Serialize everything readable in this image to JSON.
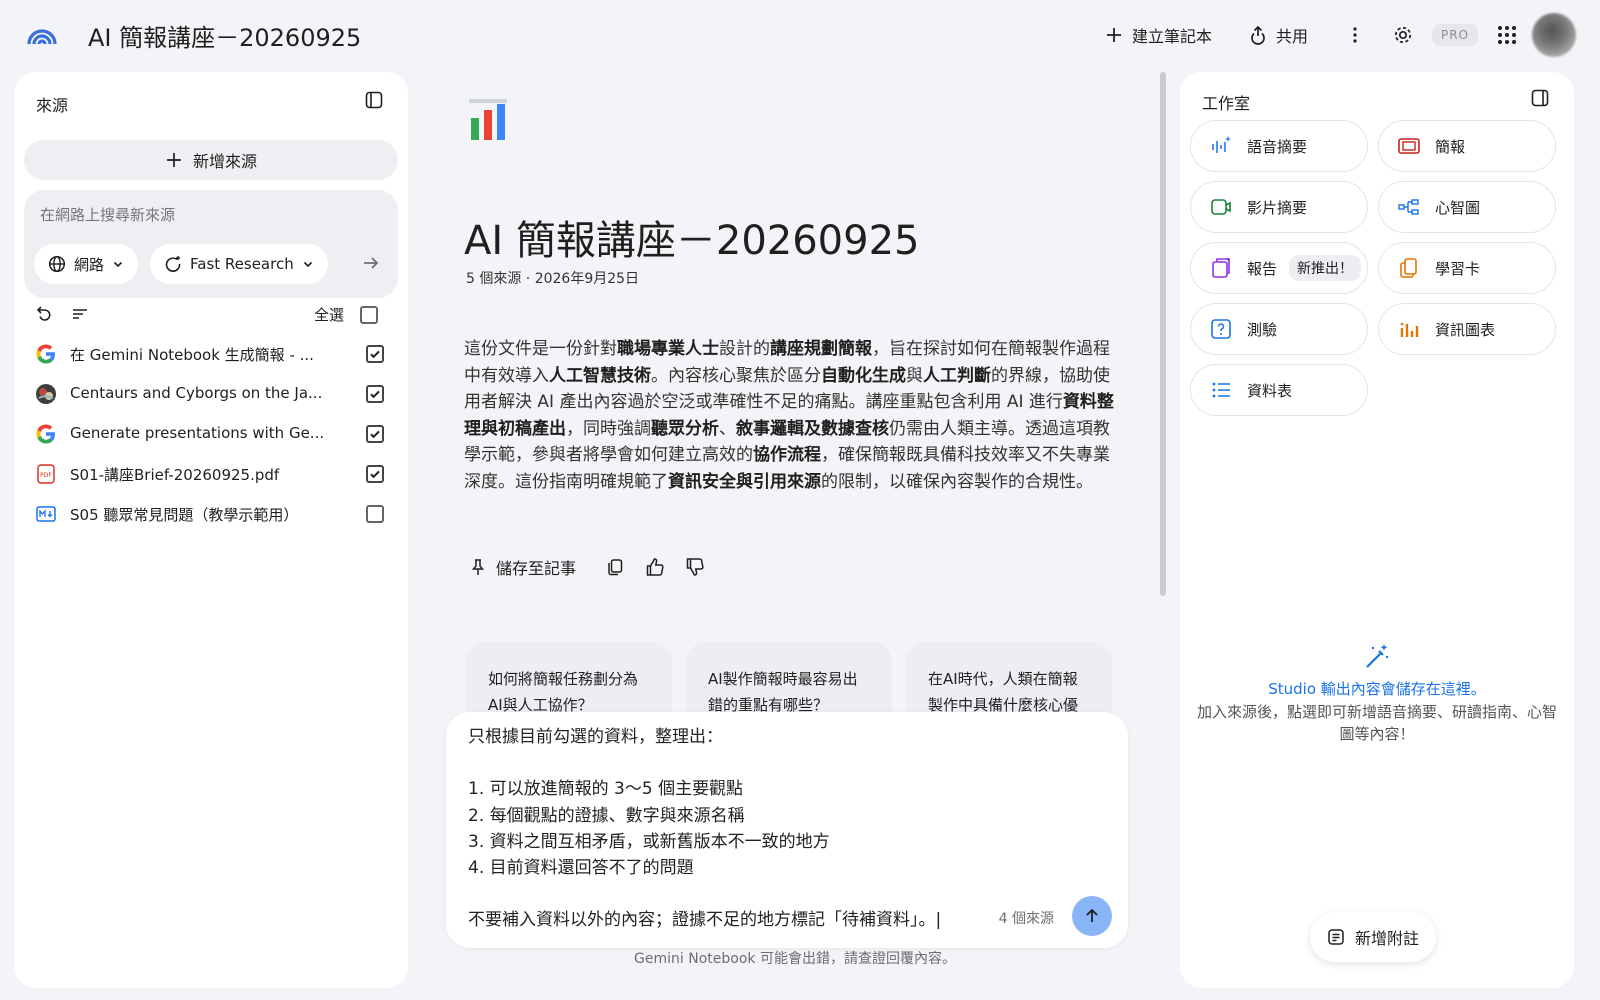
{
  "app": {
    "title": "AI 簡報講座－20260925"
  },
  "topbar": {
    "create_notebook_label": "建立筆記本",
    "share_label": "共用",
    "pro_badge": "PRO",
    "icons": [
      "plus-icon",
      "share-icon",
      "more-vert-icon",
      "settings-icon",
      "apps-grid-icon",
      "avatar"
    ]
  },
  "sources_panel": {
    "title": "來源",
    "add_source_label": "新增來源",
    "search": {
      "placeholder": "在網路上搜尋新來源",
      "value": ""
    },
    "web_chip_label": "網路",
    "research_chip_label": "Fast Research",
    "select_all_label": "全選",
    "items": [
      {
        "title": "在 Gemini Notebook 生成簡報 - ...",
        "icon": "google-icon",
        "checked": true
      },
      {
        "title": "Centaurs and Cyborgs on the Ja...",
        "icon": "web-thumbnail-icon",
        "checked": true
      },
      {
        "title": "Generate presentations with Ge...",
        "icon": "google-icon",
        "checked": true
      },
      {
        "title": "S01-講座Brief-20260925.pdf",
        "icon": "pdf-icon",
        "checked": true
      },
      {
        "title": "S05 聽眾常見問題（教學示範用）",
        "icon": "markdown-icon",
        "checked": false
      }
    ]
  },
  "main": {
    "title": "AI 簡報講座－20260925",
    "meta": "5 個來源 · 2026年9月25日",
    "summary_segments": [
      {
        "t": "這份文件是一份針對"
      },
      {
        "t": "職場專業人士",
        "b": true
      },
      {
        "t": "設計的"
      },
      {
        "t": "講座規劃簡報",
        "b": true
      },
      {
        "t": "，旨在探討如何在簡報製作過程中有效導入"
      },
      {
        "t": "人工智慧技術",
        "b": true
      },
      {
        "t": "。內容核心聚焦於區分"
      },
      {
        "t": "自動化生成",
        "b": true
      },
      {
        "t": "與"
      },
      {
        "t": "人工判斷",
        "b": true
      },
      {
        "t": "的界線，協助使用者解決 AI 產出內容過於空泛或準確性不足的痛點。講座重點包含利用 AI 進行"
      },
      {
        "t": "資料整理與初稿產出",
        "b": true
      },
      {
        "t": "，同時強調"
      },
      {
        "t": "聽眾分析",
        "b": true
      },
      {
        "t": "、"
      },
      {
        "t": "敘事邏輯及數據查核",
        "b": true
      },
      {
        "t": "仍需由人類主導。透過這項教學示範，參與者將學會如何建立高效的"
      },
      {
        "t": "協作流程",
        "b": true
      },
      {
        "t": "，確保簡報既具備科技效率又不失專業深度。這份指南明確規範了"
      },
      {
        "t": "資訊安全與引用來源",
        "b": true
      },
      {
        "t": "的限制，以確保內容製作的合規性。"
      }
    ],
    "save_note_label": "儲存至記事",
    "suggestions": [
      "如何將簡報任務劃分為AI與人工協作？",
      "AI製作簡報時最容易出錯的重點有哪些？",
      "在AI時代，人類在簡報製作中具備什麼核心優勢？"
    ],
    "composer_text": "只根據目前勾選的資料，整理出：\n\n1. 可以放進簡報的 3～5 個主要觀點\n2. 每個觀點的證據、數字與來源名稱\n3. 資料之間互相矛盾，或新舊版本不一致的地方\n4. 目前資料還回答不了的問題\n\n不要補入資料以外的內容；證據不足的地方標記「待補資料」。|",
    "source_count": "4 個來源",
    "disclaimer": "Gemini Notebook 可能會出錯，請查證回覆內容。"
  },
  "studio": {
    "title": "工作室",
    "tiles": [
      {
        "label": "語音摘要",
        "icon": "audio-overview-icon"
      },
      {
        "label": "簡報",
        "icon": "slides-icon"
      },
      {
        "label": "影片摘要",
        "icon": "video-overview-icon"
      },
      {
        "label": "心智圖",
        "icon": "mind-map-icon"
      },
      {
        "label": "報告",
        "icon": "report-icon",
        "badge": "新推出！"
      },
      {
        "label": "學習卡",
        "icon": "flashcards-icon"
      },
      {
        "label": "測驗",
        "icon": "quiz-icon"
      },
      {
        "label": "資訊圖表",
        "icon": "infographic-icon"
      },
      {
        "label": "資料表",
        "icon": "data-table-icon"
      }
    ],
    "empty_title": "Studio 輸出內容會儲存在這裡。",
    "empty_desc": "加入來源後，點選即可新增語音摘要、研讀指南、心智圖等內容！",
    "add_note_label": "新增附註"
  },
  "colors": {
    "background": "#f3f4f7",
    "panel": "#ffffff",
    "accent_blue": "#1a73e8",
    "send_button": "#8ab4f8",
    "orange": "#e37400",
    "audio_blue": "#4285f4",
    "video_green": "#188038",
    "slides_red": "#c5221f"
  }
}
